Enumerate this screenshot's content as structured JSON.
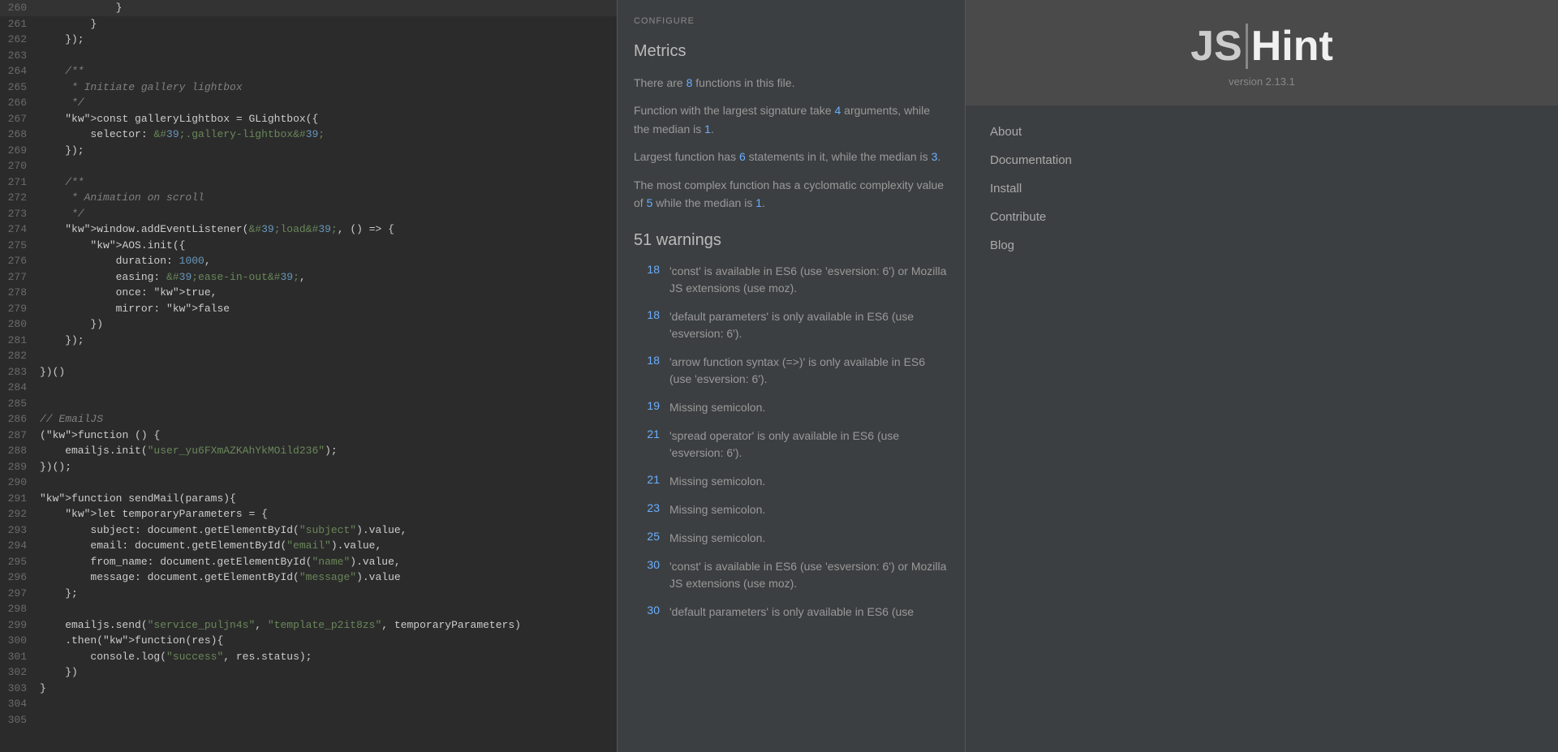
{
  "logo": {
    "js": "JS",
    "separator": "|",
    "hint": "Hint",
    "version": "version 2.13.1"
  },
  "nav": {
    "links": [
      {
        "id": "about",
        "label": "About"
      },
      {
        "id": "documentation",
        "label": "Documentation"
      },
      {
        "id": "install",
        "label": "Install"
      },
      {
        "id": "contribute",
        "label": "Contribute"
      },
      {
        "id": "blog",
        "label": "Blog"
      }
    ]
  },
  "results": {
    "configure_label": "CONFIGURE",
    "metrics_title": "Metrics",
    "metrics": [
      {
        "id": "functions-count",
        "text_before": "There are ",
        "highlight": "8",
        "text_after": " functions in this file."
      },
      {
        "id": "largest-signature",
        "text_before": "Function with the largest signature take ",
        "highlight": "4",
        "text_middle": " arguments, while the median is ",
        "highlight2": "1",
        "text_after": "."
      },
      {
        "id": "largest-function",
        "text_before": "Largest function has ",
        "highlight": "6",
        "text_middle": " statements in it, while the median is ",
        "highlight2": "3",
        "text_after": "."
      },
      {
        "id": "complex-function",
        "text_before": "The most complex function has a cyclomatic complexity value of ",
        "highlight": "5",
        "text_middle": " while the median is ",
        "highlight2": "1",
        "text_after": "."
      }
    ],
    "warnings_count": "51",
    "warnings_title": "warnings",
    "warnings": [
      {
        "line": "18",
        "text": "'const' is available in ES6 (use 'esversion: 6') or Mozilla JS extensions (use moz)."
      },
      {
        "line": "18",
        "text": "'default parameters' is only available in ES6 (use 'esversion: 6')."
      },
      {
        "line": "18",
        "text": "'arrow function syntax (=>)' is only available in ES6 (use 'esversion: 6')."
      },
      {
        "line": "19",
        "text": "Missing semicolon."
      },
      {
        "line": "21",
        "text": "'spread operator' is only available in ES6 (use 'esversion: 6')."
      },
      {
        "line": "21",
        "text": "Missing semicolon."
      },
      {
        "line": "23",
        "text": "Missing semicolon."
      },
      {
        "line": "25",
        "text": "Missing semicolon."
      },
      {
        "line": "30",
        "text": "'const' is available in ES6 (use 'esversion: 6') or Mozilla JS extensions (use moz)."
      },
      {
        "line": "30",
        "text": "'default parameters' is only available in ES6 (use"
      }
    ]
  },
  "code": {
    "lines": [
      {
        "num": "260",
        "code": "            }"
      },
      {
        "num": "261",
        "code": "        }"
      },
      {
        "num": "262",
        "code": "    });"
      },
      {
        "num": "263",
        "code": ""
      },
      {
        "num": "264",
        "code": "    /**"
      },
      {
        "num": "265",
        "code": "     * Initiate gallery lightbox"
      },
      {
        "num": "266",
        "code": "     */"
      },
      {
        "num": "267",
        "code": "    const galleryLightbox = GLightbox({"
      },
      {
        "num": "268",
        "code": "        selector: '.gallery-lightbox'"
      },
      {
        "num": "269",
        "code": "    });"
      },
      {
        "num": "270",
        "code": ""
      },
      {
        "num": "271",
        "code": "    /**"
      },
      {
        "num": "272",
        "code": "     * Animation on scroll"
      },
      {
        "num": "273",
        "code": "     */"
      },
      {
        "num": "274",
        "code": "    window.addEventListener('load', () => {"
      },
      {
        "num": "275",
        "code": "        AOS.init({"
      },
      {
        "num": "276",
        "code": "            duration: 1000,"
      },
      {
        "num": "277",
        "code": "            easing: 'ease-in-out',"
      },
      {
        "num": "278",
        "code": "            once: true,"
      },
      {
        "num": "279",
        "code": "            mirror: false"
      },
      {
        "num": "280",
        "code": "        })"
      },
      {
        "num": "281",
        "code": "    });"
      },
      {
        "num": "282",
        "code": ""
      },
      {
        "num": "283",
        "code": "})()"
      },
      {
        "num": "284",
        "code": ""
      },
      {
        "num": "285",
        "code": ""
      },
      {
        "num": "286",
        "code": "// EmailJS"
      },
      {
        "num": "287",
        "code": "(function () {"
      },
      {
        "num": "288",
        "code": "    emailjs.init(\"user_yu6FXmAZKAhYkMOild236\");"
      },
      {
        "num": "289",
        "code": "})();"
      },
      {
        "num": "290",
        "code": ""
      },
      {
        "num": "291",
        "code": "function sendMail(params){"
      },
      {
        "num": "292",
        "code": "    let temporaryParameters = {"
      },
      {
        "num": "293",
        "code": "        subject: document.getElementById(\"subject\").value,"
      },
      {
        "num": "294",
        "code": "        email: document.getElementById(\"email\").value,"
      },
      {
        "num": "295",
        "code": "        from_name: document.getElementById(\"name\").value,"
      },
      {
        "num": "296",
        "code": "        message: document.getElementById(\"message\").value"
      },
      {
        "num": "297",
        "code": "    };"
      },
      {
        "num": "298",
        "code": ""
      },
      {
        "num": "299",
        "code": "    emailjs.send(\"service_puljn4s\", \"template_p2it8zs\", temporaryParameters)"
      },
      {
        "num": "300",
        "code": "    .then(function(res){"
      },
      {
        "num": "301",
        "code": "        console.log(\"success\", res.status);"
      },
      {
        "num": "302",
        "code": "    })"
      },
      {
        "num": "303",
        "code": "}"
      },
      {
        "num": "304",
        "code": ""
      },
      {
        "num": "305",
        "code": ""
      }
    ]
  }
}
